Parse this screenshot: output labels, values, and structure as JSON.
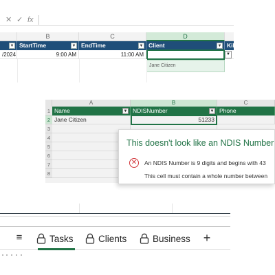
{
  "formula_bar": {
    "cancel_icon": "x-icon",
    "confirm_icon": "check-icon",
    "fx_label": "fx"
  },
  "top_sheet": {
    "columns": [
      "B",
      "C",
      "D"
    ],
    "headers": [
      "StartTime",
      "EndTime",
      "Client",
      "Kilo"
    ],
    "first_header_cut": "",
    "row": {
      "date": "/2024",
      "start": "9:00 AM",
      "end": "11:00 AM",
      "client": ""
    },
    "dropdown_option": "Jane Citizen",
    "dropdown_arrow": "▼"
  },
  "ndis_sheet": {
    "columns": [
      "A",
      "B",
      "C"
    ],
    "row_numbers": [
      "1",
      "2",
      "3",
      "4",
      "5",
      "6",
      "7",
      "8"
    ],
    "headers": [
      "Name",
      "NDISNumber",
      "Phone"
    ],
    "row2": {
      "name": "Jane Citizen",
      "ndis": "51233",
      "phone": ""
    },
    "dropdown_arrow": "▼"
  },
  "error_dialog": {
    "title": "This doesn't look like an NDIS Number",
    "icon": "error-circle-icon",
    "line1": "An NDIS Number is 9 digits and begins with 43",
    "line2": "This cell must contain a whole number between"
  },
  "tab_bar": {
    "menu_icon": "hamburger-menu-icon",
    "tabs": [
      {
        "label": "Tasks",
        "icon": "lock-icon",
        "active": true
      },
      {
        "label": "Clients",
        "icon": "lock-icon",
        "active": false
      },
      {
        "label": "Business",
        "icon": "lock-icon",
        "active": false
      }
    ],
    "add_icon": "plus-icon"
  },
  "colors": {
    "excel_green": "#217346",
    "header_blue": "#1f4e79",
    "error_red": "#d13438"
  }
}
